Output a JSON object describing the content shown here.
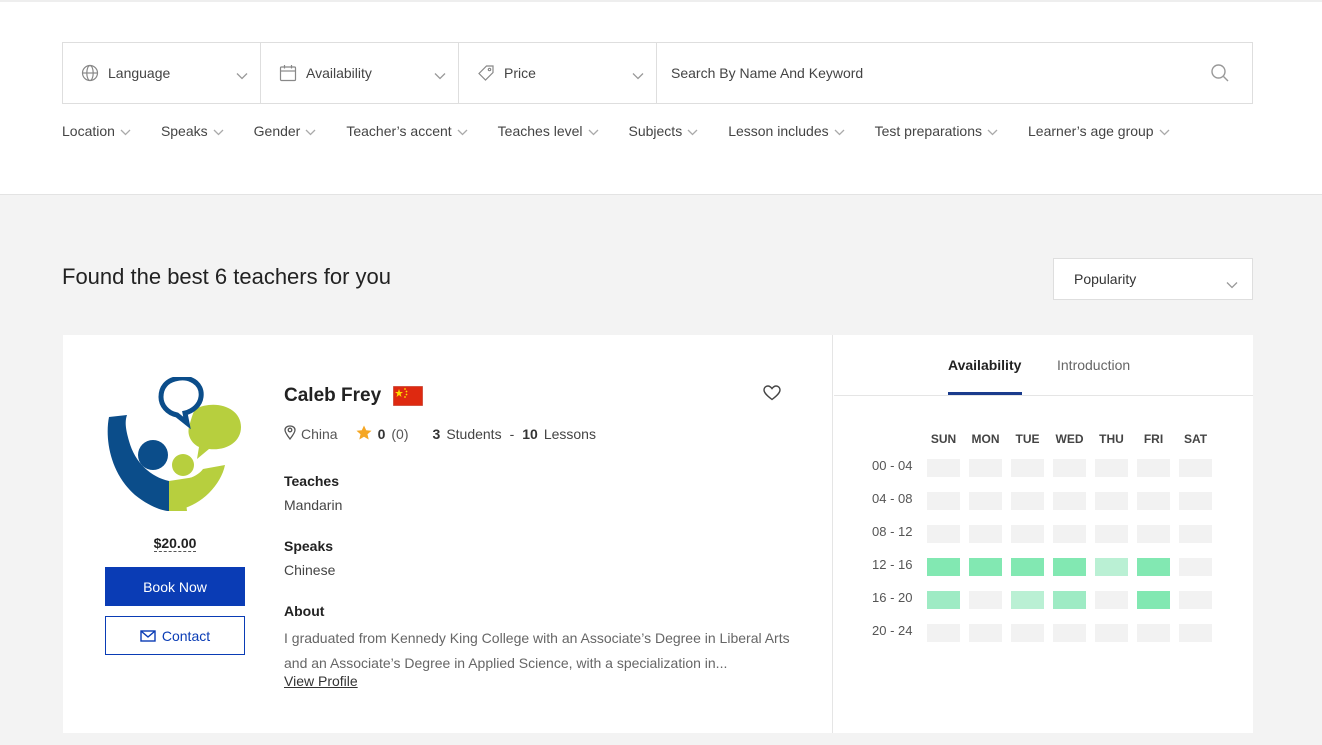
{
  "filters": {
    "language": "Language",
    "availability": "Availability",
    "price": "Price",
    "search_placeholder": "Search By Name And Keyword"
  },
  "chips": [
    "Location",
    "Speaks",
    "Gender",
    "Teacher’s accent",
    "Teaches level",
    "Subjects",
    "Lesson includes",
    "Test preparations",
    "Learner’s age group"
  ],
  "results": {
    "heading": "Found the best 6 teachers for you",
    "sort": "Popularity"
  },
  "teacher": {
    "name": "Caleb Frey",
    "country": "China",
    "rating": "0",
    "reviews": "(0)",
    "students_count": "3",
    "students_label": "Students",
    "separator": "-",
    "lessons_count": "10",
    "lessons_label": "Lessons",
    "teaches_label": "Teaches",
    "teaches": "Mandarin",
    "speaks_label": "Speaks",
    "speaks": "Chinese",
    "about_label": "About",
    "about": "I graduated from Kennedy King College with an Associate’s Degree in Liberal Arts and an Associate’s Degree in Applied Science, with a specialization in...",
    "view_profile": "View Profile",
    "price": "$20.00",
    "book_label": "Book Now",
    "contact_label": "Contact"
  },
  "tabs": {
    "availability": "Availability",
    "introduction": "Introduction"
  },
  "schedule": {
    "days": [
      "SUN",
      "MON",
      "TUE",
      "WED",
      "THU",
      "FRI",
      "SAT"
    ],
    "slots": [
      "00 - 04",
      "04 - 08",
      "08 - 12",
      "12 - 16",
      "16 - 20",
      "20 - 24"
    ],
    "levels": [
      [
        0,
        0,
        0,
        0,
        0,
        0,
        0
      ],
      [
        0,
        0,
        0,
        0,
        0,
        0,
        0
      ],
      [
        0,
        0,
        0,
        0,
        0,
        0,
        0
      ],
      [
        3,
        3,
        3,
        3,
        1,
        3,
        0
      ],
      [
        2,
        0,
        1,
        2,
        0,
        3,
        0
      ],
      [
        0,
        0,
        0,
        0,
        0,
        0,
        0
      ]
    ],
    "colors": [
      "#f2f2f2",
      "#baf0d4",
      "#9eebc4",
      "#82e8b2"
    ]
  }
}
